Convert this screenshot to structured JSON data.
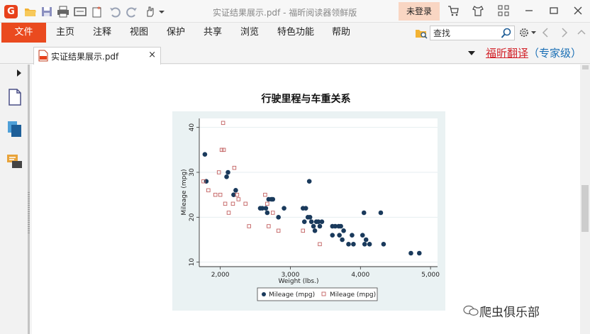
{
  "app": {
    "window_title": "实证结果展示.pdf - 福昕阅读器领鲜版",
    "login_label": "未登录",
    "logo_letter": "G"
  },
  "menu": {
    "file": "文件",
    "items": [
      "主页",
      "注释",
      "视图",
      "保护",
      "共享",
      "浏览",
      "特色功能",
      "帮助"
    ]
  },
  "search": {
    "placeholder": "查找"
  },
  "tab": {
    "label": "实证结果展示.pdf",
    "close": "×"
  },
  "translate": {
    "brand": "福昕翻译",
    "suffix": "（专家级）"
  },
  "document": {
    "title": "行驶里程与车重关系"
  },
  "watermark": "爬虫俱乐部",
  "colors": {
    "accent": "#ea4a1f",
    "marker_blue": "#1a3a5c",
    "marker_red": "#c26060",
    "chart_bg": "#eaf2f3"
  },
  "chart_data": {
    "type": "scatter",
    "title": "",
    "xlabel": "Weight (lbs.)",
    "ylabel": "Mileage (mpg)",
    "xlim": [
      1700,
      5100
    ],
    "ylim": [
      9,
      42
    ],
    "xticks": [
      2000,
      3000,
      4000,
      5000
    ],
    "xtick_labels": [
      "2,000",
      "3,000",
      "4,000",
      "5,000"
    ],
    "yticks": [
      10,
      20,
      30,
      40
    ],
    "grid": true,
    "legend_placement": "bottom",
    "series": [
      {
        "name": "Mileage (mpg)",
        "marker": "filled-circle",
        "color": "#1a3a5c",
        "points": [
          [
            1780,
            34
          ],
          [
            1800,
            28
          ],
          [
            2090,
            29
          ],
          [
            2110,
            30
          ],
          [
            2190,
            25
          ],
          [
            2220,
            26
          ],
          [
            2570,
            22
          ],
          [
            2600,
            22
          ],
          [
            2650,
            22
          ],
          [
            2670,
            21
          ],
          [
            2690,
            24
          ],
          [
            2730,
            24
          ],
          [
            2750,
            24
          ],
          [
            2830,
            20
          ],
          [
            2910,
            22
          ],
          [
            3180,
            22
          ],
          [
            3200,
            19
          ],
          [
            3220,
            22
          ],
          [
            3250,
            20
          ],
          [
            3270,
            28
          ],
          [
            3280,
            20
          ],
          [
            3300,
            19
          ],
          [
            3330,
            18
          ],
          [
            3350,
            17
          ],
          [
            3370,
            19
          ],
          [
            3400,
            19
          ],
          [
            3420,
            18
          ],
          [
            3450,
            19
          ],
          [
            3600,
            16
          ],
          [
            3600,
            18
          ],
          [
            3640,
            18
          ],
          [
            3690,
            18
          ],
          [
            3700,
            16
          ],
          [
            3720,
            18
          ],
          [
            3740,
            15
          ],
          [
            3760,
            17
          ],
          [
            3830,
            14
          ],
          [
            3880,
            16
          ],
          [
            3900,
            14
          ],
          [
            4030,
            16
          ],
          [
            4050,
            21
          ],
          [
            4060,
            14
          ],
          [
            4080,
            15
          ],
          [
            4130,
            14
          ],
          [
            4290,
            21
          ],
          [
            4330,
            14
          ],
          [
            4720,
            12
          ],
          [
            4840,
            12
          ]
        ]
      },
      {
        "name": "Mileage (mpg)",
        "marker": "hollow-square",
        "color": "#c26060",
        "points": [
          [
            1760,
            28
          ],
          [
            1830,
            26
          ],
          [
            1930,
            25
          ],
          [
            1980,
            30
          ],
          [
            2000,
            25
          ],
          [
            2020,
            35
          ],
          [
            2040,
            41
          ],
          [
            2050,
            35
          ],
          [
            2070,
            23
          ],
          [
            2120,
            21
          ],
          [
            2180,
            23
          ],
          [
            2200,
            31
          ],
          [
            2240,
            25
          ],
          [
            2260,
            24
          ],
          [
            2360,
            23
          ],
          [
            2410,
            18
          ],
          [
            2640,
            25
          ],
          [
            2670,
            23
          ],
          [
            2690,
            18
          ],
          [
            2750,
            21
          ],
          [
            2830,
            17
          ],
          [
            3180,
            17
          ],
          [
            3420,
            14
          ]
        ]
      }
    ]
  }
}
